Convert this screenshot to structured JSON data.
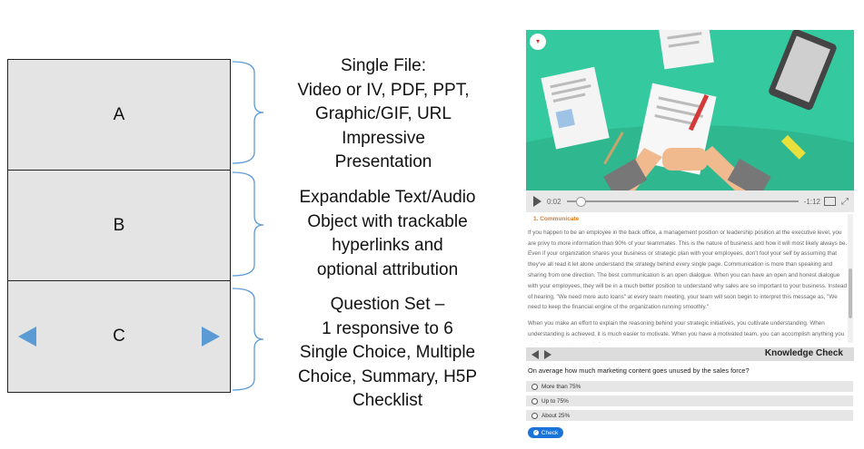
{
  "wireframe": {
    "sections": [
      "A",
      "B",
      "C"
    ]
  },
  "descriptions": {
    "a": [
      "Single File:",
      "Video or IV, PDF, PPT,",
      "Graphic/GIF, URL",
      "Impressive",
      "Presentation"
    ],
    "b": [
      "Expandable Text/Audio",
      "Object with trackable",
      "hyperlinks and",
      "optional attribution"
    ],
    "c": [
      "Question Set –",
      "1 responsive to 6",
      "Single Choice, Multiple",
      "Choice, Summary, H5P",
      "Checklist"
    ]
  },
  "video": {
    "current_time": "0:02",
    "remaining_time": "-1:12",
    "progress": 0.04
  },
  "text_panel": {
    "section_title": "1. Communicate",
    "paragraphs": [
      "If you happen to be an employee in the back office, a management position or leadership position at the executive level, you are privy to more information than 90% of your teammates. This is the nature of business and how it will most likely always be. Even if your organization shares your business or strategic plan with your employees, don't fool your self by assuming that they've all read it let alone understand the strategy behind every single page. Communication is more than speaking and sharing from one direction. The best communication is an open dialogue. When you can have an open and honest dialogue with your employees, they will be in a much better position to understand why sales are so important to your business. Instead of hearing, \"We need more auto loans\" at every team meeting, your team will soon begin to interpret this message as, \"We need to keep the financial engine of the organization running smoothly.\"",
      "When you make an effort to explain the reasoning behind your strategic initiatives, you cultivate understanding.  When understanding is achieved, it is much easier to motivate. When you have a motivated team, you can accomplish anything you and your team put your minds to."
    ]
  },
  "knowledge_check": {
    "title": "Knowledge Check",
    "question": "On average how much marketing content goes unused by the sales force?",
    "options": [
      "More than 75%",
      "Up to 75%",
      "About 25%"
    ],
    "check_label": "Check"
  },
  "colors": {
    "arrow_blue": "#5b9bd5",
    "brace_blue": "#5b9bd5",
    "illustration_green": "#35c9a0",
    "accent_orange": "#e07a1f",
    "button_blue": "#1a73d9"
  }
}
